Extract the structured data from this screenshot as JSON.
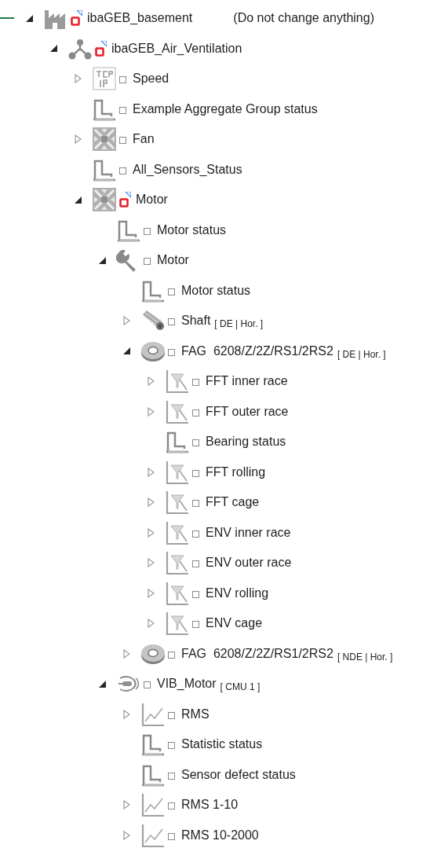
{
  "tree": [
    {
      "kind": "plant",
      "label": "ibaGEB_basement",
      "note": "(Do not change anything)",
      "alarm": true,
      "expanded": true,
      "children": [
        {
          "kind": "branch",
          "label": "ibaGEB_Air_Ventilation",
          "alarm": true,
          "expanded": true,
          "children": [
            {
              "kind": "tcpip",
              "label": "Speed",
              "alarm": false,
              "expanded": false
            },
            {
              "kind": "status",
              "label": "Example Aggregate Group status",
              "alarm": false
            },
            {
              "kind": "fan",
              "label": "Fan",
              "alarm": false,
              "expanded": false
            },
            {
              "kind": "status",
              "label": "All_Sensors_Status",
              "alarm": false
            },
            {
              "kind": "fan",
              "label": "Motor",
              "alarm": true,
              "expanded": true,
              "children": [
                {
                  "kind": "status",
                  "label": "Motor status",
                  "alarm": false
                },
                {
                  "kind": "wrench",
                  "label": "Motor",
                  "alarm": false,
                  "expanded": true,
                  "children": [
                    {
                      "kind": "status",
                      "label": "Motor status",
                      "alarm": false
                    },
                    {
                      "kind": "shaft",
                      "label": "Shaft",
                      "tag": "[ DE | Hor. ]",
                      "alarm": false,
                      "expanded": false
                    },
                    {
                      "kind": "bearing",
                      "label": "FAG  6208/Z/2Z/RS1/2RS2",
                      "tag": "[ DE | Hor. ]",
                      "alarm": false,
                      "expanded": true,
                      "children": [
                        {
                          "kind": "fft",
                          "label": "FFT inner race",
                          "alarm": false,
                          "expanded": false
                        },
                        {
                          "kind": "fft",
                          "label": "FFT outer race",
                          "alarm": false,
                          "expanded": false
                        },
                        {
                          "kind": "status",
                          "label": "Bearing status",
                          "alarm": false
                        },
                        {
                          "kind": "fft",
                          "label": "FFT rolling",
                          "alarm": false,
                          "expanded": false
                        },
                        {
                          "kind": "fft",
                          "label": "FFT cage",
                          "alarm": false,
                          "expanded": false
                        },
                        {
                          "kind": "fft",
                          "label": "ENV inner race",
                          "alarm": false,
                          "expanded": false
                        },
                        {
                          "kind": "fft",
                          "label": "ENV outer race",
                          "alarm": false,
                          "expanded": false
                        },
                        {
                          "kind": "fft",
                          "label": "ENV rolling",
                          "alarm": false,
                          "expanded": false
                        },
                        {
                          "kind": "fft",
                          "label": "ENV cage",
                          "alarm": false,
                          "expanded": false
                        }
                      ]
                    },
                    {
                      "kind": "bearing",
                      "label": "FAG  6208/Z/2Z/RS1/2RS2",
                      "tag": "[ NDE | Hor. ]",
                      "alarm": false,
                      "expanded": false
                    }
                  ]
                },
                {
                  "kind": "sensor",
                  "label": "VIB_Motor",
                  "tag": "[ CMU 1 ]",
                  "alarm": false,
                  "expanded": true,
                  "children": [
                    {
                      "kind": "trend",
                      "label": "RMS",
                      "alarm": false,
                      "expanded": false
                    },
                    {
                      "kind": "status",
                      "label": "Statistic status",
                      "alarm": false
                    },
                    {
                      "kind": "status",
                      "label": "Sensor defect status",
                      "alarm": false
                    },
                    {
                      "kind": "trend",
                      "label": "RMS 1-10",
                      "alarm": false,
                      "expanded": false
                    },
                    {
                      "kind": "trend",
                      "label": "RMS 10-2000",
                      "alarm": false,
                      "expanded": false
                    }
                  ]
                }
              ]
            }
          ]
        }
      ]
    }
  ]
}
